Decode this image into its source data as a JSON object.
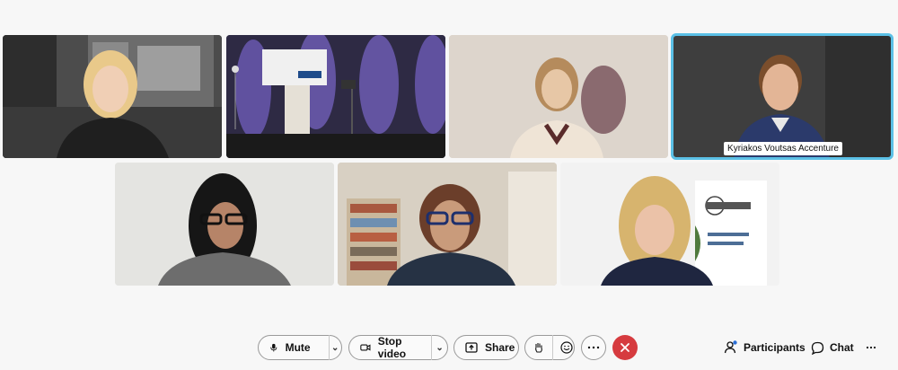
{
  "meeting": {
    "participants_tiles": [
      {
        "name": "",
        "active": false
      },
      {
        "name": "",
        "active": false
      },
      {
        "name": "",
        "active": false
      },
      {
        "name": "Kyriakos Voutsas Accenture",
        "active": true
      },
      {
        "name": "",
        "active": false
      },
      {
        "name": "",
        "active": false
      },
      {
        "name": "",
        "active": false
      }
    ]
  },
  "toolbar": {
    "mute_label": "Mute",
    "stop_video_label": "Stop video",
    "share_label": "Share",
    "participants_label": "Participants",
    "chat_label": "Chat"
  },
  "colors": {
    "leave": "#d63b3f",
    "active_border": "#5bc0e6",
    "participants_dot": "#2b6fd6"
  }
}
